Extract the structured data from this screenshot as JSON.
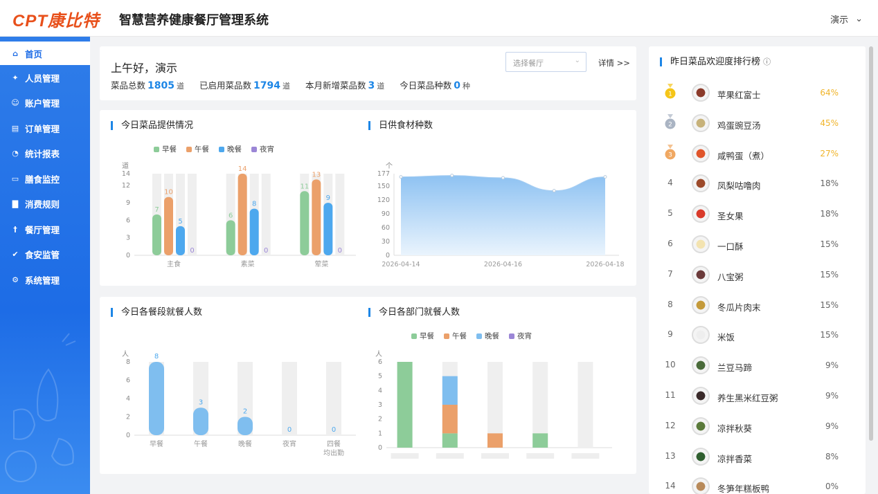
{
  "header": {
    "logo": "CPT康比特",
    "title": "智慧营养健康餐厅管理系统",
    "user": "演示"
  },
  "sidebar": {
    "items": [
      {
        "label": "首页",
        "icon": "home-icon"
      },
      {
        "label": "人员管理",
        "icon": "people-icon"
      },
      {
        "label": "账户管理",
        "icon": "account-icon"
      },
      {
        "label": "订单管理",
        "icon": "order-icon"
      },
      {
        "label": "统计报表",
        "icon": "pie-icon"
      },
      {
        "label": "膳食监控",
        "icon": "monitor-icon"
      },
      {
        "label": "消费规则",
        "icon": "bar-icon"
      },
      {
        "label": "餐厅管理",
        "icon": "fork-icon"
      },
      {
        "label": "食安监管",
        "icon": "check-icon"
      },
      {
        "label": "系统管理",
        "icon": "gear-icon"
      }
    ]
  },
  "overview": {
    "greeting": "上午好，演示",
    "select_placeholder": "选择餐厅",
    "detail": "详情 >>",
    "stats": [
      {
        "label": "菜品总数",
        "value": "1805",
        "unit": "道"
      },
      {
        "label": "已启用菜品数",
        "value": "1794",
        "unit": "道"
      },
      {
        "label": "本月新增菜品数",
        "value": "3",
        "unit": "道"
      },
      {
        "label": "今日菜品种数",
        "value": "0",
        "unit": "种"
      }
    ]
  },
  "legend": [
    "早餐",
    "午餐",
    "晚餐",
    "夜宵"
  ],
  "colors": {
    "breakfast": "#8dcc99",
    "lunch": "#eba06a",
    "dinner": "#4da8ee",
    "night": "#9b86d6",
    "dinner_light": "#7fbeef"
  },
  "chart_data": [
    {
      "type": "bar",
      "title": "今日菜品提供情况",
      "ylabel": "道",
      "ylim": [
        0,
        14
      ],
      "yticks": [
        0,
        3,
        6,
        9,
        12,
        14
      ],
      "categories": [
        "主食",
        "素菜",
        "荤菜"
      ],
      "series": [
        {
          "name": "早餐",
          "values": [
            7,
            6,
            11
          ]
        },
        {
          "name": "午餐",
          "values": [
            10,
            14,
            13
          ]
        },
        {
          "name": "晚餐",
          "values": [
            5,
            8,
            9
          ]
        },
        {
          "name": "夜宵",
          "values": [
            0,
            0,
            0
          ]
        }
      ]
    },
    {
      "type": "area",
      "title": "日供食材种数",
      "ylabel": "个",
      "ylim": [
        0,
        177
      ],
      "yticks": [
        0,
        30,
        60,
        90,
        120,
        150,
        177
      ],
      "x": [
        "2026-04-14",
        "2026-04-15",
        "2026-04-16",
        "2026-04-17",
        "2026-04-18"
      ],
      "xticks": [
        "2026-04-14",
        "2026-04-16",
        "2026-04-18"
      ],
      "values": [
        170,
        173,
        168,
        140,
        170
      ]
    },
    {
      "type": "bar",
      "title": "今日各餐段就餐人数",
      "ylabel": "人",
      "ylim": [
        0,
        8
      ],
      "yticks": [
        0,
        2,
        4,
        6,
        8
      ],
      "categories": [
        "早餐",
        "午餐",
        "晚餐",
        "夜宵",
        "四餐均出勤"
      ],
      "values": [
        8,
        3,
        2,
        0,
        0
      ]
    },
    {
      "type": "bar",
      "title": "今日各部门就餐人数",
      "ylabel": "人",
      "ylim": [
        0,
        6
      ],
      "yticks": [
        0,
        1,
        2,
        3,
        4,
        5,
        6
      ],
      "series": [
        {
          "name": "早餐",
          "values": [
            6,
            1,
            0,
            1,
            0
          ]
        },
        {
          "name": "午餐",
          "values": [
            0,
            2,
            1,
            0,
            0
          ]
        },
        {
          "name": "晚餐",
          "values": [
            0,
            2,
            0,
            0,
            0
          ]
        },
        {
          "name": "夜宵",
          "values": [
            0,
            0,
            0,
            0,
            0
          ]
        }
      ]
    }
  ],
  "ranking": {
    "title": "昨日菜品欢迎度排行榜",
    "items": [
      {
        "rank": "1",
        "name": "苹果红富士",
        "pct": "64%"
      },
      {
        "rank": "2",
        "name": "鸡蛋豌豆汤",
        "pct": "45%"
      },
      {
        "rank": "3",
        "name": "咸鸭蛋（煮）",
        "pct": "27%"
      },
      {
        "rank": "4",
        "name": "凤梨咕噜肉",
        "pct": "18%"
      },
      {
        "rank": "5",
        "name": "圣女果",
        "pct": "18%"
      },
      {
        "rank": "6",
        "name": "一口酥",
        "pct": "15%"
      },
      {
        "rank": "7",
        "name": "八宝粥",
        "pct": "15%"
      },
      {
        "rank": "8",
        "name": "冬瓜片肉末",
        "pct": "15%"
      },
      {
        "rank": "9",
        "name": "米饭",
        "pct": "15%"
      },
      {
        "rank": "10",
        "name": "兰豆马蹄",
        "pct": "9%"
      },
      {
        "rank": "11",
        "name": "养生黑米红豆粥",
        "pct": "9%"
      },
      {
        "rank": "12",
        "name": "凉拌秋葵",
        "pct": "9%"
      },
      {
        "rank": "13",
        "name": "凉拌香菜",
        "pct": "8%"
      },
      {
        "rank": "14",
        "name": "冬笋年糕板鸭",
        "pct": "0%"
      }
    ]
  }
}
